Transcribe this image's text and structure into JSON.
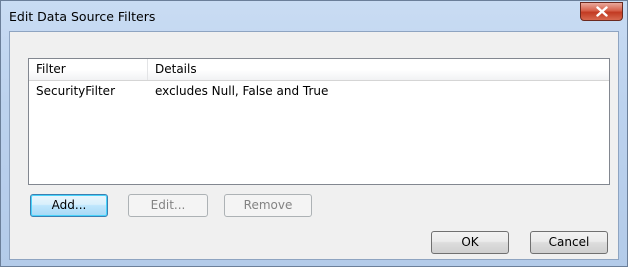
{
  "window": {
    "title": "Edit Data Source Filters"
  },
  "list": {
    "columns": [
      "Filter",
      "Details"
    ],
    "rows": [
      {
        "filter": "SecurityFilter",
        "details": "excludes Null, False and True"
      }
    ]
  },
  "actions": {
    "add_label": "Add...",
    "edit_label": "Edit...",
    "remove_label": "Remove"
  },
  "footer": {
    "ok_label": "OK",
    "cancel_label": "Cancel"
  },
  "icons": {
    "close": "close-icon"
  },
  "colors": {
    "title_bar": "#bcd2ee",
    "close_button": "#c23a22",
    "default_button_border": "#3c7fb1",
    "disabled_text": "#838383"
  }
}
